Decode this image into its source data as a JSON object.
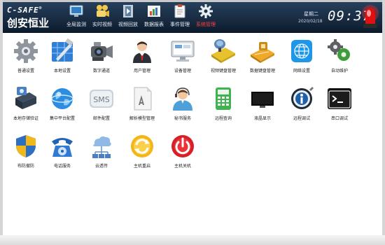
{
  "brand": {
    "en": "C-SAFE",
    "cn": "创安恒业",
    "registered": "®"
  },
  "nav": [
    {
      "label": "全局监测",
      "icon": "monitor-icon"
    },
    {
      "label": "实时视频",
      "icon": "camera-icon"
    },
    {
      "label": "视频回放",
      "icon": "film-icon"
    },
    {
      "label": "数据报表",
      "icon": "report-icon"
    },
    {
      "label": "事件管理",
      "icon": "clipboard-icon"
    },
    {
      "label": "系统管理",
      "icon": "gear-icon",
      "active": true
    }
  ],
  "clock": {
    "weekday": "星期二",
    "date": "2020/02/18",
    "time": "09:37"
  },
  "tiles": [
    {
      "label": "普通设置",
      "icon": "gear-icon"
    },
    {
      "label": "本地设置",
      "icon": "blueprint-icon"
    },
    {
      "label": "数字通道",
      "icon": "camera-icon"
    },
    {
      "label": "用户管理",
      "icon": "user-icon"
    },
    {
      "label": "设备管理",
      "icon": "display-icon"
    },
    {
      "label": "视频键盘管理",
      "icon": "keyboard-yellow-icon"
    },
    {
      "label": "数据键盘管理",
      "icon": "keyboard-orange-icon"
    },
    {
      "label": "网络设置",
      "icon": "network-icon"
    },
    {
      "label": "自动维护",
      "icon": "gears-icon"
    },
    {
      "label": "本地存储验证",
      "icon": "storage-icon"
    },
    {
      "label": "集中平台配置",
      "icon": "globe-icon"
    },
    {
      "label": "邮件配置",
      "icon": "sms-icon"
    },
    {
      "label": "解析模型管理",
      "icon": "document-icon"
    },
    {
      "label": "秘书服务",
      "icon": "headset-user-icon"
    },
    {
      "label": "远程查询",
      "icon": "calculator-icon"
    },
    {
      "label": "液晶显示",
      "icon": "lcd-icon"
    },
    {
      "label": "远程调试",
      "icon": "info-icon"
    },
    {
      "label": "串口调试",
      "icon": "terminal-icon"
    },
    {
      "label": "布防撤防",
      "icon": "shield-icon"
    },
    {
      "label": "电话服务",
      "icon": "telephone-icon"
    },
    {
      "label": "云透传",
      "icon": "cloud-icon"
    },
    {
      "label": "主机重启",
      "icon": "restart-icon"
    },
    {
      "label": "主机关机",
      "icon": "power-icon"
    }
  ],
  "colors": {
    "topbar": "#13263b",
    "active_nav": "#ff4040"
  }
}
